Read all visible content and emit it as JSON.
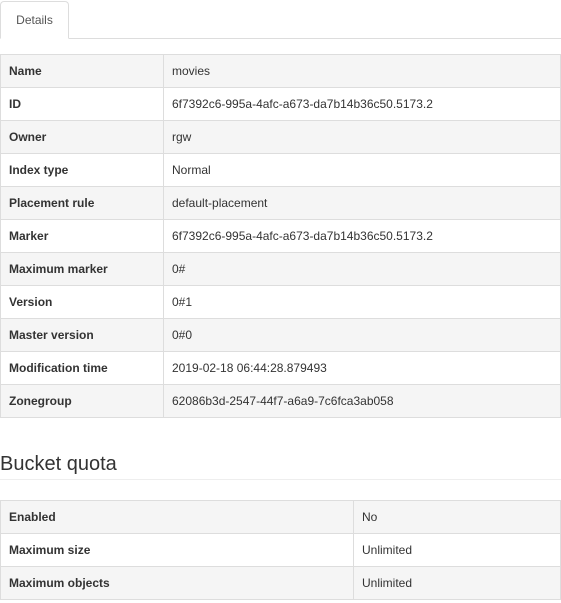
{
  "tabs": [
    {
      "label": "Details",
      "active": true
    }
  ],
  "details": {
    "rows": [
      {
        "key": "Name",
        "value": "movies"
      },
      {
        "key": "ID",
        "value": "6f7392c6-995a-4afc-a673-da7b14b36c50.5173.2"
      },
      {
        "key": "Owner",
        "value": "rgw"
      },
      {
        "key": "Index type",
        "value": "Normal"
      },
      {
        "key": "Placement rule",
        "value": "default-placement"
      },
      {
        "key": "Marker",
        "value": "6f7392c6-995a-4afc-a673-da7b14b36c50.5173.2"
      },
      {
        "key": "Maximum marker",
        "value": "0#"
      },
      {
        "key": "Version",
        "value": "0#1"
      },
      {
        "key": "Master version",
        "value": "0#0"
      },
      {
        "key": "Modification time",
        "value": "2019-02-18 06:44:28.879493"
      },
      {
        "key": "Zonegroup",
        "value": "62086b3d-2547-44f7-a6a9-7c6fca3ab058"
      }
    ]
  },
  "bucket_quota": {
    "title": "Bucket quota",
    "rows": [
      {
        "key": "Enabled",
        "value": "No"
      },
      {
        "key": "Maximum size",
        "value": "Unlimited"
      },
      {
        "key": "Maximum objects",
        "value": "Unlimited"
      }
    ]
  },
  "colors": {
    "border": "#dddddd",
    "stripe": "#f5f5f5",
    "text": "#333333",
    "tab_text": "#555555"
  }
}
